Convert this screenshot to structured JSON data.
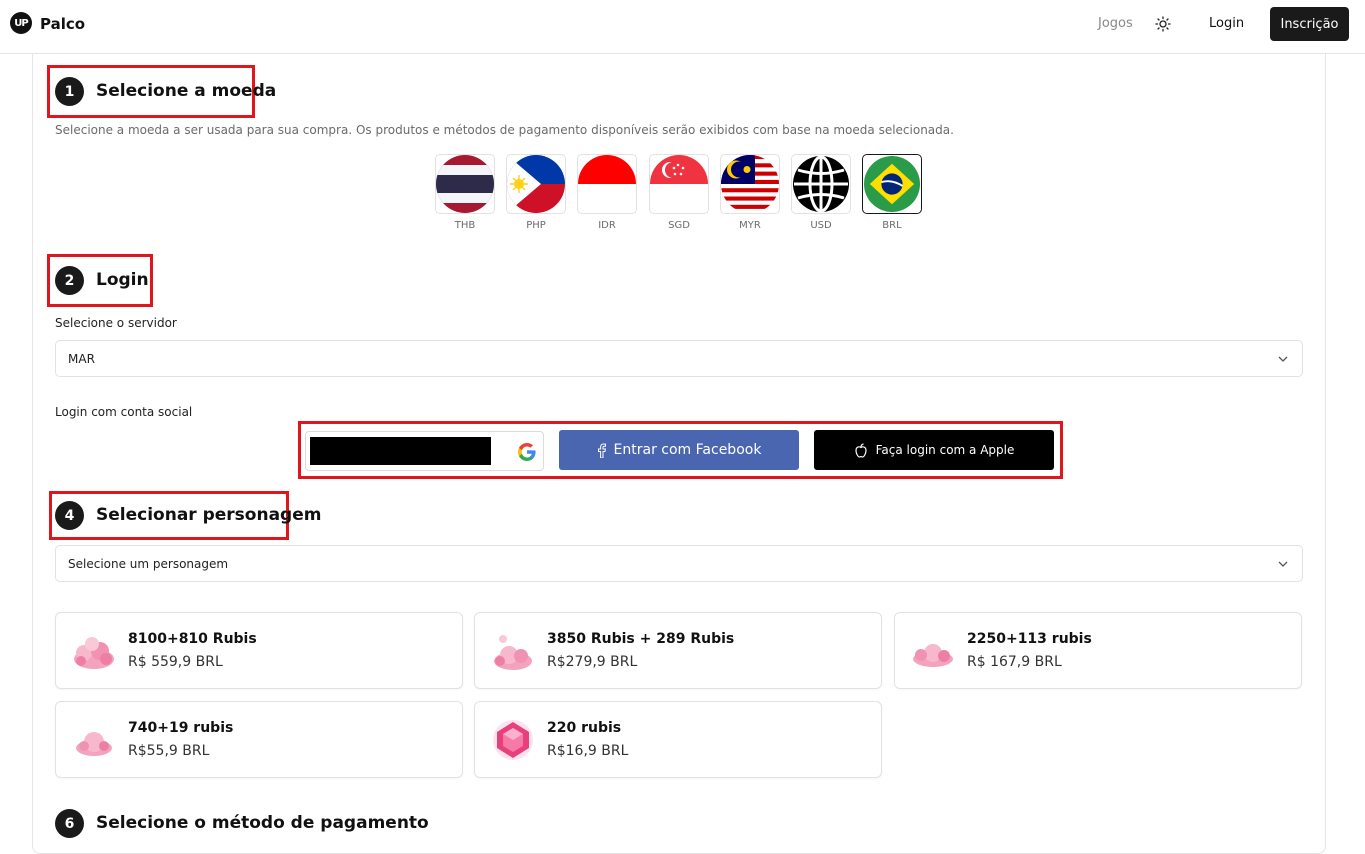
{
  "header": {
    "logo_text": "UP",
    "brand": "Palco",
    "nav_games": "Jogos",
    "nav_login": "Login",
    "nav_signup": "Inscrição"
  },
  "steps": {
    "currency": {
      "number": "1",
      "title": "Selecione a moeda",
      "description": "Selecione a moeda a ser usada para sua compra. Os produtos e métodos de pagamento disponíveis serão exibidos com base na moeda selecionada."
    },
    "login": {
      "number": "2",
      "title": "Login"
    },
    "character": {
      "number": "4",
      "title": "Selecionar personagem"
    },
    "payment": {
      "number": "6",
      "title": "Selecione o método de pagamento"
    }
  },
  "currencies": [
    {
      "code": "THB",
      "icon": "thailand-flag-icon"
    },
    {
      "code": "PHP",
      "icon": "philippines-flag-icon"
    },
    {
      "code": "IDR",
      "icon": "indonesia-flag-icon"
    },
    {
      "code": "SGD",
      "icon": "singapore-flag-icon"
    },
    {
      "code": "MYR",
      "icon": "malaysia-flag-icon"
    },
    {
      "code": "USD",
      "icon": "globe-icon"
    },
    {
      "code": "BRL",
      "icon": "brazil-flag-icon",
      "selected": true
    }
  ],
  "server": {
    "label": "Selecione o servidor",
    "value": "MAR"
  },
  "social": {
    "label": "Login com conta social",
    "facebook": "Entrar com Facebook",
    "apple": "Faça login com a Apple"
  },
  "character": {
    "placeholder": "Selecione um personagem"
  },
  "products": [
    {
      "name": "8100+810 Rubis",
      "price": "R$ 559,9 BRL",
      "icon": "ruby-pile-icon"
    },
    {
      "name": "3850 Rubis + 289 Rubis",
      "price": "R$279,9 BRL",
      "icon": "ruby-pile-icon"
    },
    {
      "name": "2250+113 rubis",
      "price": "R$ 167,9 BRL",
      "icon": "ruby-pile-icon"
    },
    {
      "name": "740+19 rubis",
      "price": "R$55,9 BRL",
      "icon": "ruby-pile-icon"
    },
    {
      "name": "220 rubis",
      "price": "R$16,9 BRL",
      "icon": "ruby-gem-icon"
    }
  ],
  "colors": {
    "accent": "#1a1a1a",
    "highlight_box": "#e0161c",
    "facebook": "#4a66b1",
    "apple": "#000000"
  }
}
